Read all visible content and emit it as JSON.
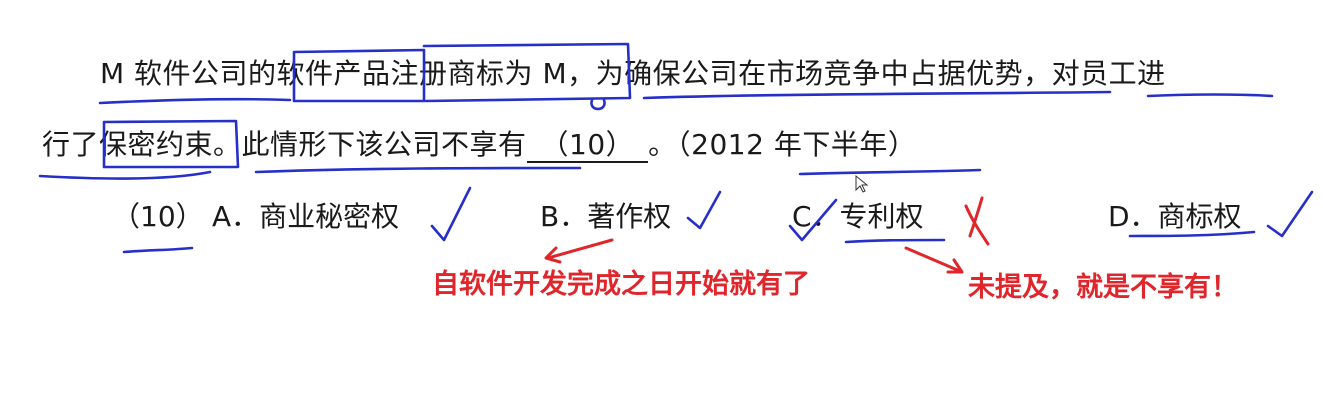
{
  "question": {
    "line1": "M 软件公司的软件产品注册商标为 M，为确保公司在市场竞争中占据优势，对员工进",
    "line2_start": "行了保密约束。此情形下该公司不享有",
    "blank": "（10）",
    "line2_end": "。（2012 年下半年）"
  },
  "options": {
    "number": "（10）",
    "a": "A．商业秘密权",
    "b": "B．著作权",
    "c": "C．专利权",
    "d": "D．商标权"
  },
  "notes": {
    "b": "自软件开发完成之日开始就有了",
    "c": "未提及，就是不享有！"
  },
  "colors": {
    "handwriting": "#2630c8",
    "annotation": "#e0262b"
  }
}
